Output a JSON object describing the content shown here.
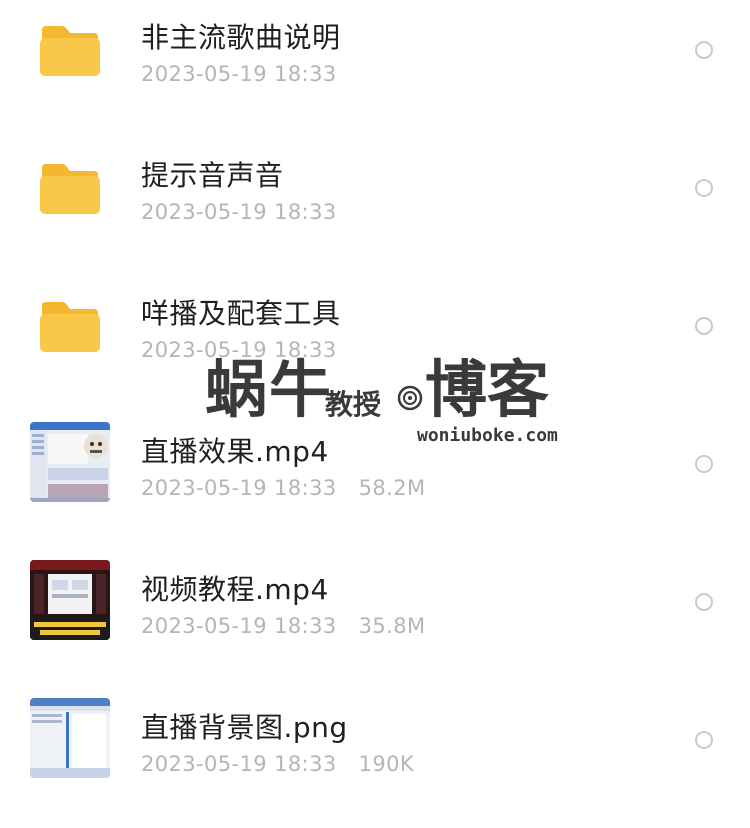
{
  "files": [
    {
      "name": "非主流歌曲说明",
      "date": "2023-05-19 18:33",
      "size": "",
      "type": "folder",
      "icon": "folder-icon"
    },
    {
      "name": "提示音声音",
      "date": "2023-05-19 18:33",
      "size": "",
      "type": "folder",
      "icon": "folder-icon"
    },
    {
      "name": "咩播及配套工具",
      "date": "2023-05-19 18:33",
      "size": "",
      "type": "folder",
      "icon": "folder-icon"
    },
    {
      "name": "直播效果.mp4",
      "date": "2023-05-19 18:33",
      "size": "58.2M",
      "type": "video",
      "icon": "video-thumbnail"
    },
    {
      "name": "视频教程.mp4",
      "date": "2023-05-19 18:33",
      "size": "35.8M",
      "type": "video",
      "icon": "video-thumbnail"
    },
    {
      "name": "直播背景图.png",
      "date": "2023-05-19 18:33",
      "size": "190K",
      "type": "image",
      "icon": "image-thumbnail"
    }
  ],
  "watermark": {
    "left_text": "蜗牛",
    "middle_text": "教授",
    "right_text": "博客",
    "url": "woniuboke.com"
  },
  "colors": {
    "folder": "#f9c84a",
    "folder_tab": "#f3b82f",
    "text_primary": "#1f1f1f",
    "text_secondary": "#b5b5b5",
    "radio_border": "#c9c9c9"
  }
}
